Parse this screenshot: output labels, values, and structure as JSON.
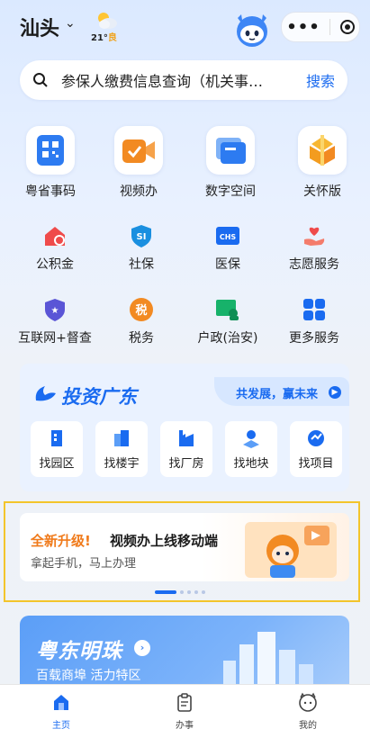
{
  "header": {
    "city": "汕头",
    "temp": "21°",
    "quality": "良"
  },
  "search": {
    "placeholder": "参保人缴费信息查询（机关事…",
    "button": "搜索"
  },
  "big_services": [
    {
      "label": "粤省事码",
      "icon": "qr-code-icon"
    },
    {
      "label": "视频办",
      "icon": "video-office-icon"
    },
    {
      "label": "数字空间",
      "icon": "digital-space-icon"
    },
    {
      "label": "关怀版",
      "icon": "care-mode-icon"
    }
  ],
  "small_services": [
    {
      "label": "公积金",
      "icon": "housing-fund-icon"
    },
    {
      "label": "社保",
      "icon": "social-security-icon"
    },
    {
      "label": "医保",
      "icon": "medical-insurance-icon"
    },
    {
      "label": "志愿服务",
      "icon": "volunteer-icon"
    },
    {
      "label": "互联网+督查",
      "icon": "inspection-icon"
    },
    {
      "label": "税务",
      "icon": "tax-icon"
    },
    {
      "label": "户政(治安)",
      "icon": "household-icon"
    },
    {
      "label": "更多服务",
      "icon": "more-services-icon"
    }
  ],
  "invest": {
    "title": "投资广东",
    "slogan": "共发展，赢未来",
    "items": [
      "找园区",
      "找楼宇",
      "找厂房",
      "找地块",
      "找项目"
    ]
  },
  "banner": {
    "highlight": "全新升级!",
    "title": "视频办上线移动端",
    "subtitle": "拿起手机，马上办理"
  },
  "pearl": {
    "title": "粤东明珠",
    "subtitle": "百载商埠 活力特区"
  },
  "tabs": [
    "主页",
    "办事",
    "我的"
  ],
  "colors": {
    "accent": "#1a6bf0",
    "orange": "#f07a1a",
    "banner_frame": "#f3c52b"
  }
}
